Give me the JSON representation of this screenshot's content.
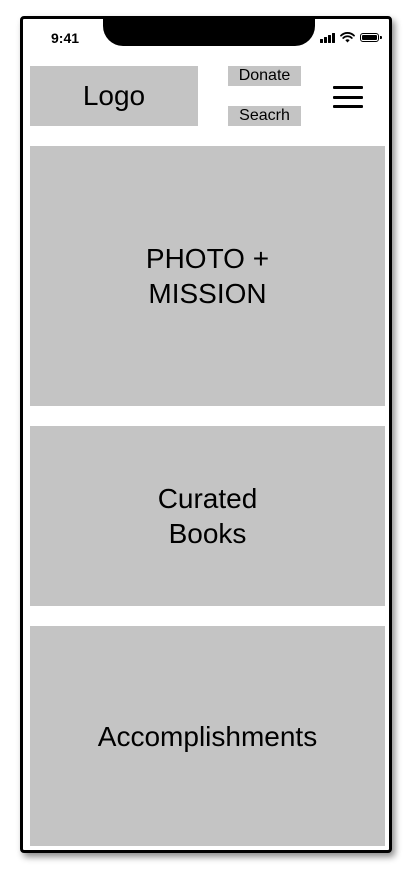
{
  "status_bar": {
    "time": "9:41",
    "icons": [
      "signal-icon",
      "wifi-icon",
      "battery-icon"
    ]
  },
  "header": {
    "logo": "Logo",
    "donate_label": "Donate",
    "search_label": "Seacrh",
    "menu_icon": "hamburger-menu-icon"
  },
  "sections": [
    {
      "label": "PHOTO +\nMISSION"
    },
    {
      "label": "Curated\nBooks"
    },
    {
      "label": "Accomplishments"
    }
  ],
  "colors": {
    "placeholder_gray": "#c4c4c4",
    "frame": "#000000",
    "background": "#ffffff"
  }
}
